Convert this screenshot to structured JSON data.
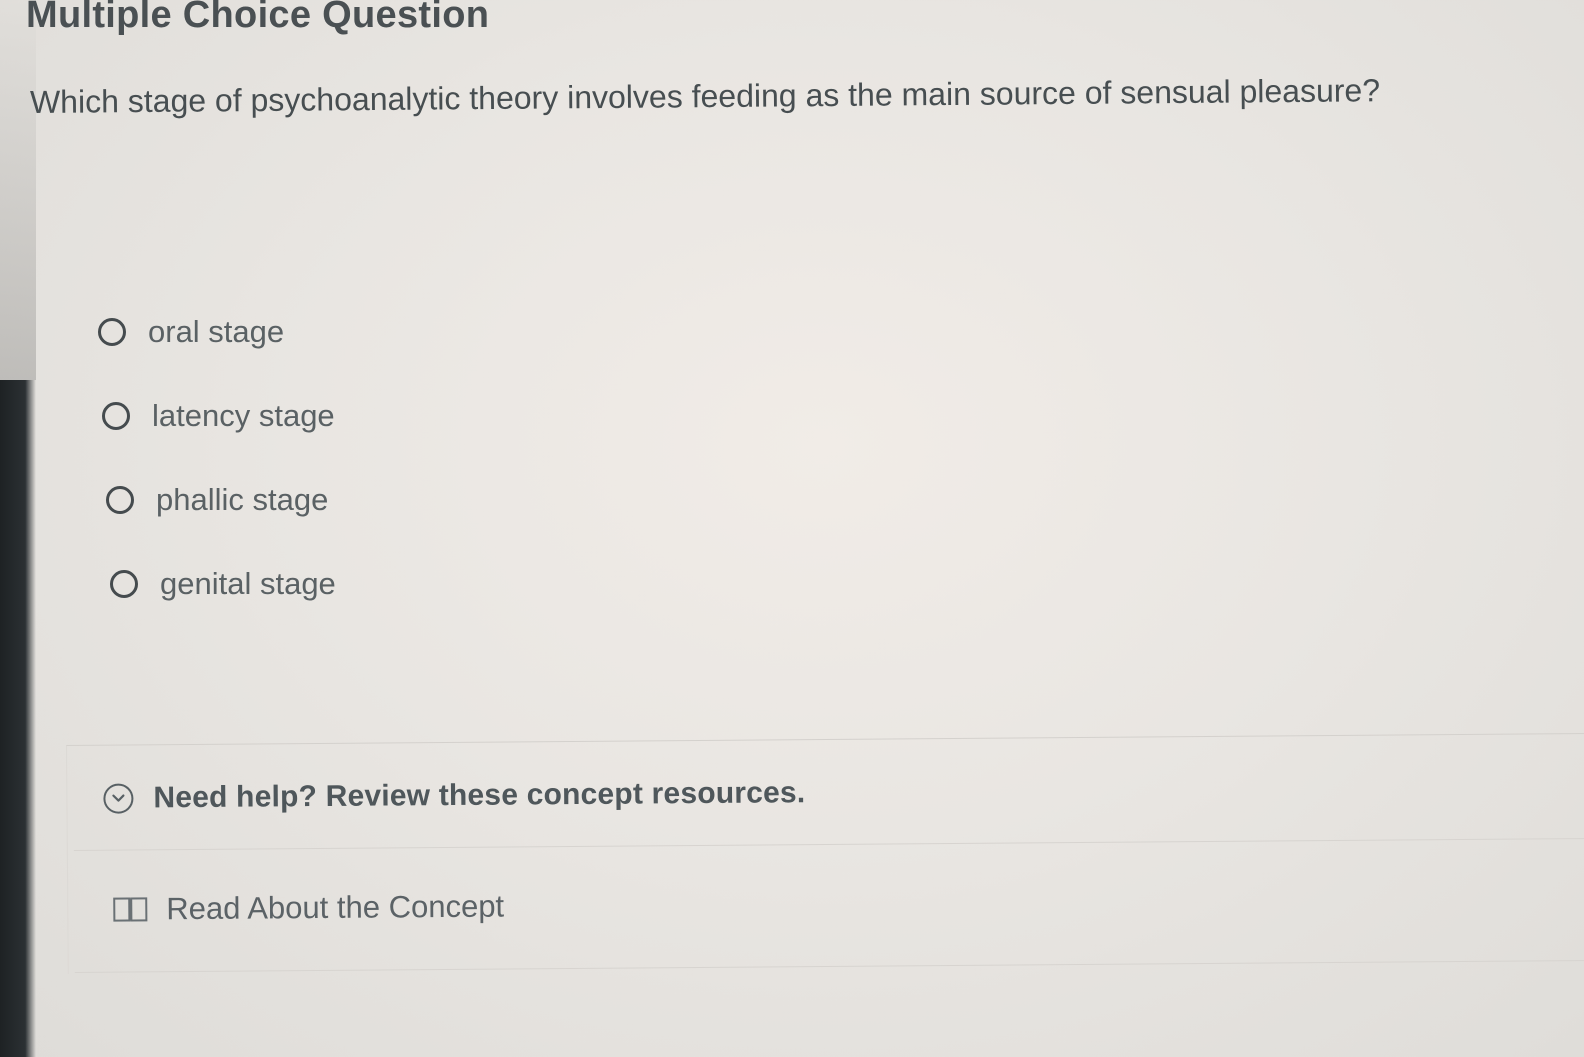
{
  "question_block": {
    "heading": "Multiple Choice Question",
    "question_text": "Which stage of psychoanalytic theory involves feeding as the main source of sensual pleasure?",
    "options": [
      {
        "label": "oral stage",
        "selected": false
      },
      {
        "label": "latency stage",
        "selected": false
      },
      {
        "label": "phallic stage",
        "selected": false
      },
      {
        "label": "genital stage",
        "selected": false
      }
    ]
  },
  "help": {
    "toggle_label": "Need help? Review these concept resources.",
    "toggle_icon": "chevron-down-circle-icon",
    "resources": [
      {
        "label": "Read About the Concept",
        "icon": "book-icon"
      }
    ]
  }
}
